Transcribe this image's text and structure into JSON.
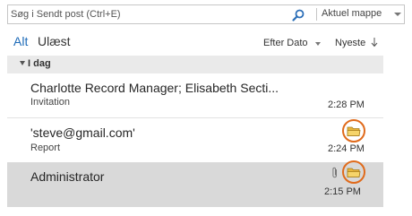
{
  "search": {
    "placeholder": "Søg i Sendt post (Ctrl+E)",
    "scope": "Aktuel mappe"
  },
  "filters": {
    "all": "Alt",
    "unread": "Ulæst"
  },
  "sort": {
    "by": "Efter Dato",
    "order": "Nyeste"
  },
  "group": {
    "label": "I dag"
  },
  "messages": [
    {
      "sender": "Charlotte Record Manager; Elisabeth Secti...",
      "subject": "Invitation",
      "time": "2:28 PM",
      "attachment": false,
      "folder_icon": false,
      "selected": false
    },
    {
      "sender": "'steve@gmail.com'",
      "subject": "Report",
      "time": "2:24 PM",
      "attachment": false,
      "folder_icon": true,
      "selected": false
    },
    {
      "sender": "Administrator",
      "subject": "",
      "time": "2:15 PM",
      "attachment": true,
      "folder_icon": true,
      "selected": true
    }
  ],
  "colors": {
    "accent": "#1e6bb8",
    "highlight_circle": "#e06b1c",
    "selected_row": "#d9d9d9",
    "group_header": "#eaeaea"
  },
  "icons": {
    "search": "search-icon",
    "folder": "folder-icon",
    "attachment": "paperclip-icon"
  }
}
